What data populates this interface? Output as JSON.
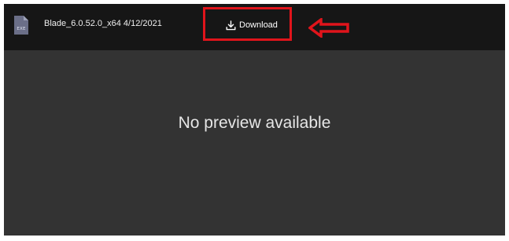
{
  "topbar": {
    "file": {
      "icon": "exe-file-icon",
      "extension_label": "EXE",
      "name_date": "Blade_6.0.52.0_x64 4/12/2021"
    },
    "download": {
      "icon": "download-icon",
      "label": "Download"
    },
    "annotation": {
      "icon": "left-arrow-outline-icon",
      "color": "#e0141b"
    }
  },
  "preview": {
    "message": "No preview available"
  },
  "colors": {
    "topbar_bg": "#161616",
    "content_bg": "#333333",
    "file_icon": "#6b6f88",
    "highlight": "#e0141b"
  }
}
